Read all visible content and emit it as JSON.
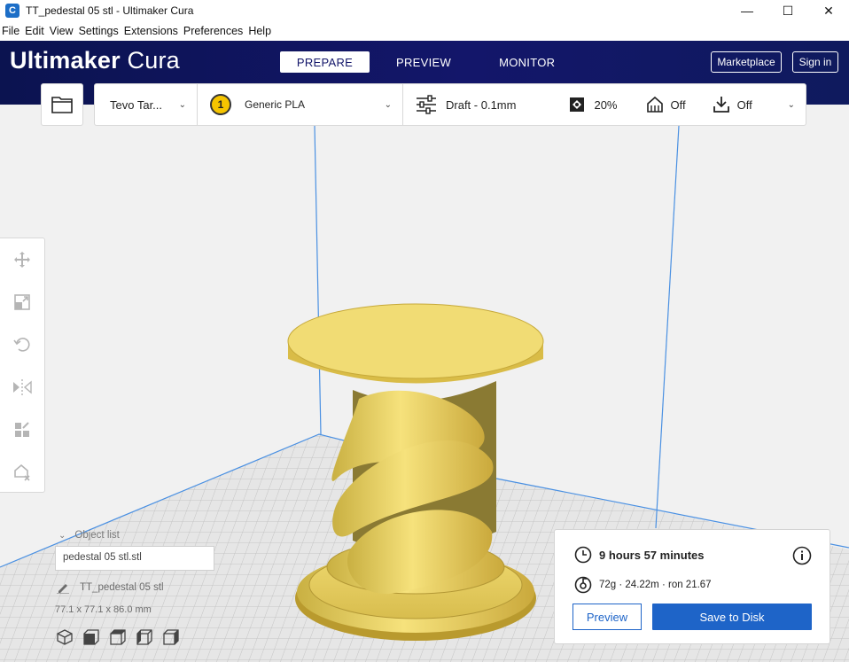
{
  "window": {
    "title": "TT_pedestal 05  stl - Ultimaker Cura",
    "app_icon_glyph": "C",
    "controls": {
      "minimize": "—",
      "maximize": "☐",
      "close": "✕"
    }
  },
  "menu": [
    "File",
    "Edit",
    "View",
    "Settings",
    "Extensions",
    "Preferences",
    "Help"
  ],
  "header": {
    "logo_bold": "Ultimaker",
    "logo_light": " Cura",
    "tabs": [
      {
        "label": "PREPARE",
        "active": true
      },
      {
        "label": "PREVIEW",
        "active": false
      },
      {
        "label": "MONITOR",
        "active": false
      }
    ],
    "marketplace_label": "Marketplace",
    "signin_label": "Sign in"
  },
  "toolbar": {
    "printer": "Tevo Tar...",
    "extruder_number": "1",
    "material": "Generic PLA",
    "profile": "Draft - 0.1mm",
    "infill": "20%",
    "support": "Off",
    "adhesion": "Off"
  },
  "objects": {
    "list_title": "Object list",
    "list_item": "pedestal 05  stl.stl",
    "selected_name": "TT_pedestal 05  stl",
    "dimensions": "77.1 x 77.1 x 86.0 mm"
  },
  "print": {
    "time": "9 hours 57 minutes",
    "material_usage": "72g · 24.22m · ron 21.67",
    "preview_label": "Preview",
    "save_label": "Save to Disk"
  },
  "colors": {
    "header_bg": "#13166a",
    "accent_blue": "#1e64c8",
    "model_yellow": "#f3dc6e"
  }
}
